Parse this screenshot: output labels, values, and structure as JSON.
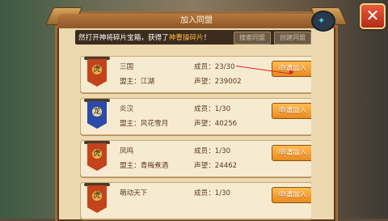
{
  "dialog": {
    "title": "加入同盟",
    "notice_prefix": "然打开神将碎片宝箱，获得了",
    "notice_highlight": "神曹操碎片",
    "notice_suffix": "！",
    "filter_buttons": [
      "搜索同盟",
      "创建同盟"
    ]
  },
  "labels": {
    "members": "成员：",
    "leader": "盟主：",
    "prestige": "声望：",
    "apply": "申请加入"
  },
  "alliances": [
    {
      "name": "三国",
      "leader": "江湖",
      "members": "23/30",
      "prestige": "239002",
      "flag_color": "#c2431c",
      "emblem": "虎"
    },
    {
      "name": "炎汉",
      "leader": "风花雪月",
      "members": "1/30",
      "prestige": "40256",
      "flag_color": "#2c4aa8",
      "emblem": "龙"
    },
    {
      "name": "凤鸣",
      "leader": "青梅煮酒",
      "members": "1/30",
      "prestige": "24462",
      "flag_color": "#c2431c",
      "emblem": "虎"
    },
    {
      "name": "萌动天下",
      "leader": "",
      "members": "1/30",
      "prestige": "",
      "flag_color": "#c2431c",
      "emblem": "虎"
    }
  ],
  "icons": {
    "close": "close-icon",
    "top_badge": "game-badge-icon"
  },
  "colors": {
    "panel_bg": "#ecd9b0",
    "apply_button": "#f0a03a",
    "highlight": "#ffb43a",
    "annotation": "#e02020"
  }
}
